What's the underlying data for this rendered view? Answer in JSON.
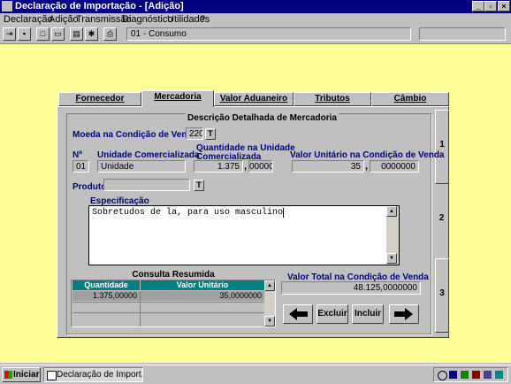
{
  "window": {
    "title": "Declaração de Importação - [Adição]"
  },
  "menu": [
    "Declaração",
    "Adição",
    "Transmissão",
    "Diagnóstico",
    "Utilidades",
    "?"
  ],
  "toolbar": {
    "field_value": "01 - Consumo"
  },
  "tabs": [
    "Fornecedor",
    "Mercadoria",
    "Valor Aduaneiro",
    "Tributos",
    "Câmbio"
  ],
  "active_tab": "Mercadoria",
  "side_tabs": [
    "1",
    "2",
    "3"
  ],
  "form": {
    "section_title": "Descrição Detalhada de Mercadoria",
    "moeda_label": "Moeda na Condição de Venda",
    "moeda_value": "220",
    "t_button": "T",
    "num_label": "Nº",
    "num_value": "01",
    "unidade_label": "Unidade Comercializada",
    "unidade_value": "Unidade",
    "quantidade_label_1": "Quantidade na Unidade",
    "quantidade_label_2": "Comercializada",
    "quantidade_int": "1.375",
    "quantidade_sep": ",",
    "quantidade_dec": "00000",
    "valor_unit_label": "Valor Unitário na Condição de Venda",
    "valor_unit_int": "35",
    "valor_unit_sep": ",",
    "valor_unit_dec": "0000000",
    "produto_label": "Produto",
    "produto_value": "",
    "especificacao_label": "Especificação",
    "especificacao_value": "Sobretudos de la, para uso masculino",
    "total_label": "Valor Total na Condição de Venda",
    "total_value": "48.125,0000000"
  },
  "summary": {
    "title": "Consulta Resumida",
    "columns": [
      "Quantidade",
      "Valor Unitário"
    ],
    "rows": [
      [
        "1.375,00000",
        "35,0000000"
      ]
    ]
  },
  "buttons": {
    "excluir": "Excluir",
    "incluir": "Incluir"
  },
  "taskbar": {
    "start": "Iniciar",
    "task": "Declaração de Import..."
  }
}
